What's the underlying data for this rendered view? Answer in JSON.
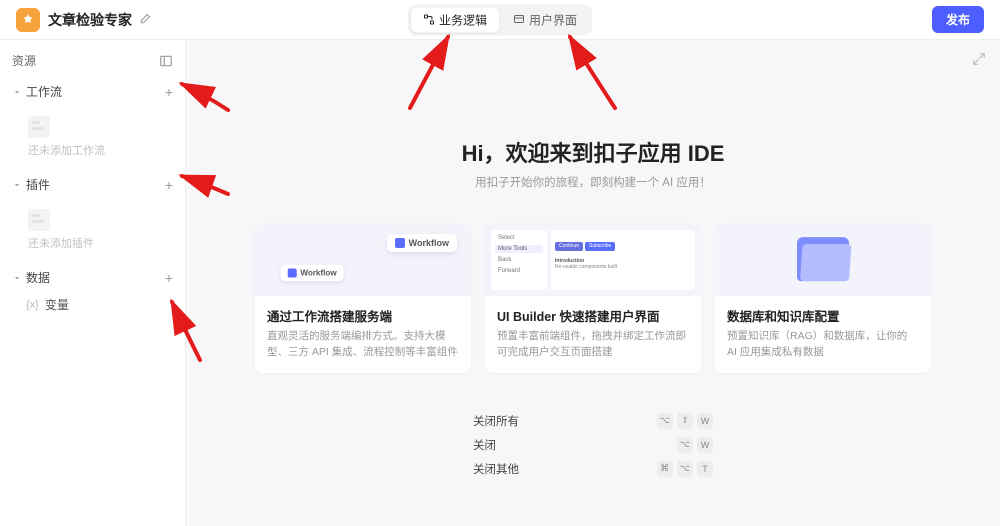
{
  "header": {
    "app_title": "文章检验专家",
    "tab_logic": "业务逻辑",
    "tab_ui": "用户界面",
    "publish": "发布"
  },
  "sidebar": {
    "title": "资源",
    "sections": {
      "workflow": {
        "label": "工作流",
        "empty": "还未添加工作流"
      },
      "plugin": {
        "label": "插件",
        "empty": "还未添加插件"
      },
      "data": {
        "label": "数据"
      }
    },
    "data_leaf": "变量"
  },
  "hero": {
    "title": "Hi，欢迎来到扣子应用 IDE",
    "subtitle": "用扣子开始你的旅程，即刻构建一个 AI 应用！"
  },
  "cards": [
    {
      "preview_chip": "Workflow",
      "title": "通过工作流搭建服务端",
      "desc": "直观灵活的服务端编排方式。支持大模型、三方 API 集成、流程控制等丰富组件"
    },
    {
      "preview": {
        "items": [
          "Select",
          "More Tools",
          "Back",
          "Forward"
        ],
        "btn_a": "Continue",
        "btn_b": "Subscribe",
        "intro_title": "Introduction",
        "intro_text": "Re-usable components built"
      },
      "title": "UI Builder 快速搭建用户界面",
      "desc": "预置丰富前端组件，拖拽并绑定工作流即可完成用户交互页面搭建"
    },
    {
      "title": "数据库和知识库配置",
      "desc": "预置知识库（RAG）和数据库，让你的 AI 应用集成私有数据"
    }
  ],
  "shortcuts": {
    "close_all": {
      "label": "关闭所有",
      "keys": [
        "⌥",
        "⇧",
        "W"
      ]
    },
    "close": {
      "label": "关闭",
      "keys": [
        "⌥",
        "W"
      ]
    },
    "close_others": {
      "label": "关闭其他",
      "keys": [
        "⌘",
        "⌥",
        "T"
      ]
    }
  }
}
